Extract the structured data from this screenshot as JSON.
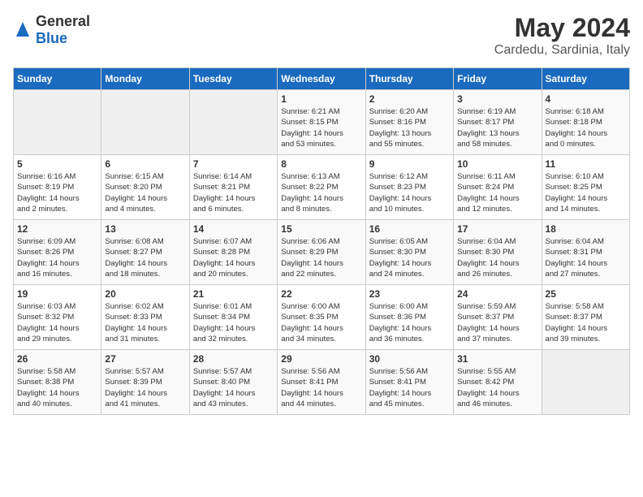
{
  "header": {
    "logo_general": "General",
    "logo_blue": "Blue",
    "month": "May 2024",
    "location": "Cardedu, Sardinia, Italy"
  },
  "weekdays": [
    "Sunday",
    "Monday",
    "Tuesday",
    "Wednesday",
    "Thursday",
    "Friday",
    "Saturday"
  ],
  "weeks": [
    [
      {
        "day": "",
        "info": ""
      },
      {
        "day": "",
        "info": ""
      },
      {
        "day": "",
        "info": ""
      },
      {
        "day": "1",
        "info": "Sunrise: 6:21 AM\nSunset: 8:15 PM\nDaylight: 14 hours\nand 53 minutes."
      },
      {
        "day": "2",
        "info": "Sunrise: 6:20 AM\nSunset: 8:16 PM\nDaylight: 13 hours\nand 55 minutes."
      },
      {
        "day": "3",
        "info": "Sunrise: 6:19 AM\nSunset: 8:17 PM\nDaylight: 13 hours\nand 58 minutes."
      },
      {
        "day": "4",
        "info": "Sunrise: 6:18 AM\nSunset: 8:18 PM\nDaylight: 14 hours\nand 0 minutes."
      }
    ],
    [
      {
        "day": "5",
        "info": "Sunrise: 6:16 AM\nSunset: 8:19 PM\nDaylight: 14 hours\nand 2 minutes."
      },
      {
        "day": "6",
        "info": "Sunrise: 6:15 AM\nSunset: 8:20 PM\nDaylight: 14 hours\nand 4 minutes."
      },
      {
        "day": "7",
        "info": "Sunrise: 6:14 AM\nSunset: 8:21 PM\nDaylight: 14 hours\nand 6 minutes."
      },
      {
        "day": "8",
        "info": "Sunrise: 6:13 AM\nSunset: 8:22 PM\nDaylight: 14 hours\nand 8 minutes."
      },
      {
        "day": "9",
        "info": "Sunrise: 6:12 AM\nSunset: 8:23 PM\nDaylight: 14 hours\nand 10 minutes."
      },
      {
        "day": "10",
        "info": "Sunrise: 6:11 AM\nSunset: 8:24 PM\nDaylight: 14 hours\nand 12 minutes."
      },
      {
        "day": "11",
        "info": "Sunrise: 6:10 AM\nSunset: 8:25 PM\nDaylight: 14 hours\nand 14 minutes."
      }
    ],
    [
      {
        "day": "12",
        "info": "Sunrise: 6:09 AM\nSunset: 8:26 PM\nDaylight: 14 hours\nand 16 minutes."
      },
      {
        "day": "13",
        "info": "Sunrise: 6:08 AM\nSunset: 8:27 PM\nDaylight: 14 hours\nand 18 minutes."
      },
      {
        "day": "14",
        "info": "Sunrise: 6:07 AM\nSunset: 8:28 PM\nDaylight: 14 hours\nand 20 minutes."
      },
      {
        "day": "15",
        "info": "Sunrise: 6:06 AM\nSunset: 8:29 PM\nDaylight: 14 hours\nand 22 minutes."
      },
      {
        "day": "16",
        "info": "Sunrise: 6:05 AM\nSunset: 8:30 PM\nDaylight: 14 hours\nand 24 minutes."
      },
      {
        "day": "17",
        "info": "Sunrise: 6:04 AM\nSunset: 8:30 PM\nDaylight: 14 hours\nand 26 minutes."
      },
      {
        "day": "18",
        "info": "Sunrise: 6:04 AM\nSunset: 8:31 PM\nDaylight: 14 hours\nand 27 minutes."
      }
    ],
    [
      {
        "day": "19",
        "info": "Sunrise: 6:03 AM\nSunset: 8:32 PM\nDaylight: 14 hours\nand 29 minutes."
      },
      {
        "day": "20",
        "info": "Sunrise: 6:02 AM\nSunset: 8:33 PM\nDaylight: 14 hours\nand 31 minutes."
      },
      {
        "day": "21",
        "info": "Sunrise: 6:01 AM\nSunset: 8:34 PM\nDaylight: 14 hours\nand 32 minutes."
      },
      {
        "day": "22",
        "info": "Sunrise: 6:00 AM\nSunset: 8:35 PM\nDaylight: 14 hours\nand 34 minutes."
      },
      {
        "day": "23",
        "info": "Sunrise: 6:00 AM\nSunset: 8:36 PM\nDaylight: 14 hours\nand 36 minutes."
      },
      {
        "day": "24",
        "info": "Sunrise: 5:59 AM\nSunset: 8:37 PM\nDaylight: 14 hours\nand 37 minutes."
      },
      {
        "day": "25",
        "info": "Sunrise: 5:58 AM\nSunset: 8:37 PM\nDaylight: 14 hours\nand 39 minutes."
      }
    ],
    [
      {
        "day": "26",
        "info": "Sunrise: 5:58 AM\nSunset: 8:38 PM\nDaylight: 14 hours\nand 40 minutes."
      },
      {
        "day": "27",
        "info": "Sunrise: 5:57 AM\nSunset: 8:39 PM\nDaylight: 14 hours\nand 41 minutes."
      },
      {
        "day": "28",
        "info": "Sunrise: 5:57 AM\nSunset: 8:40 PM\nDaylight: 14 hours\nand 43 minutes."
      },
      {
        "day": "29",
        "info": "Sunrise: 5:56 AM\nSunset: 8:41 PM\nDaylight: 14 hours\nand 44 minutes."
      },
      {
        "day": "30",
        "info": "Sunrise: 5:56 AM\nSunset: 8:41 PM\nDaylight: 14 hours\nand 45 minutes."
      },
      {
        "day": "31",
        "info": "Sunrise: 5:55 AM\nSunset: 8:42 PM\nDaylight: 14 hours\nand 46 minutes."
      },
      {
        "day": "",
        "info": ""
      }
    ]
  ]
}
